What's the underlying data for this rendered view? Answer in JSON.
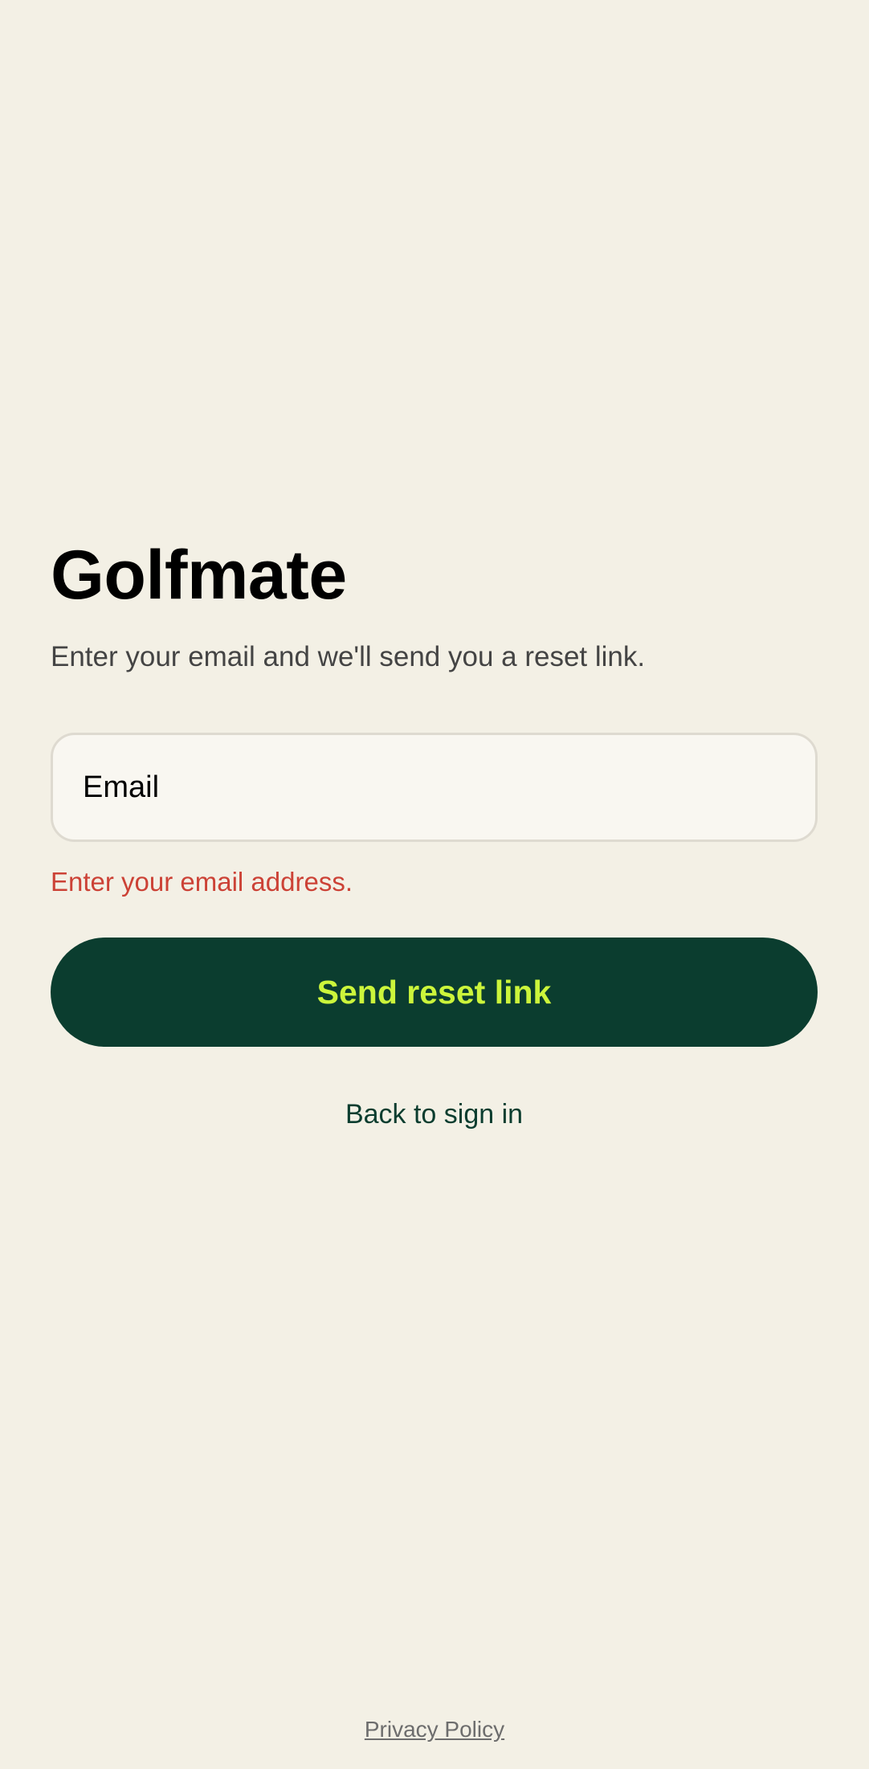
{
  "app": {
    "title": "Golfmate",
    "subtitle": "Enter your email and we'll send you a reset link."
  },
  "form": {
    "email_placeholder": "Email",
    "email_value": "",
    "error_message": "Enter your email address.",
    "submit_label": "Send reset link",
    "back_label": "Back to sign in"
  },
  "footer": {
    "privacy_label": "Privacy Policy"
  },
  "colors": {
    "background": "#f3f0e5",
    "button_background": "#0b3d2f",
    "button_text": "#ccf53b",
    "error": "#cc4236"
  }
}
